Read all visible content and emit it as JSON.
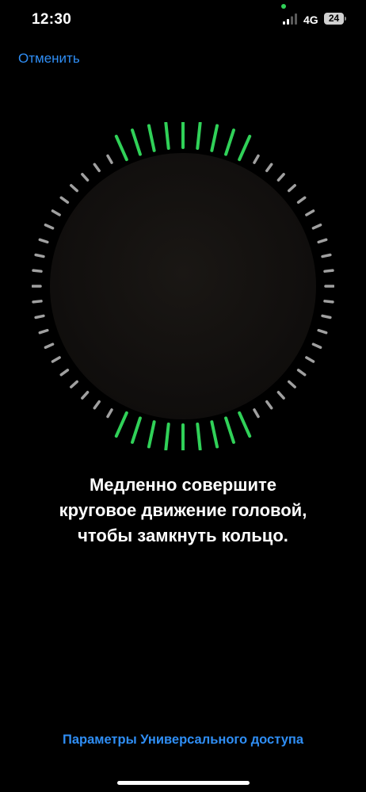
{
  "status_bar": {
    "time": "12:30",
    "network": "4G",
    "battery_level": "24",
    "privacy_dot_color": "#30d158",
    "signal_icon": "signal-bars-icon"
  },
  "header": {
    "cancel_label": "Отменить"
  },
  "face_scan": {
    "progress_color": "#30d158",
    "pending_color": "#a0a0a0",
    "camera_preview_color": "#14110f"
  },
  "instruction_text": "Медленно совершите\nкруговое движение головой,\nчтобы замкнуть кольцо.",
  "footer": {
    "accessibility_label": "Параметры Универсального доступа"
  },
  "accent_color": "#2f8ef5"
}
